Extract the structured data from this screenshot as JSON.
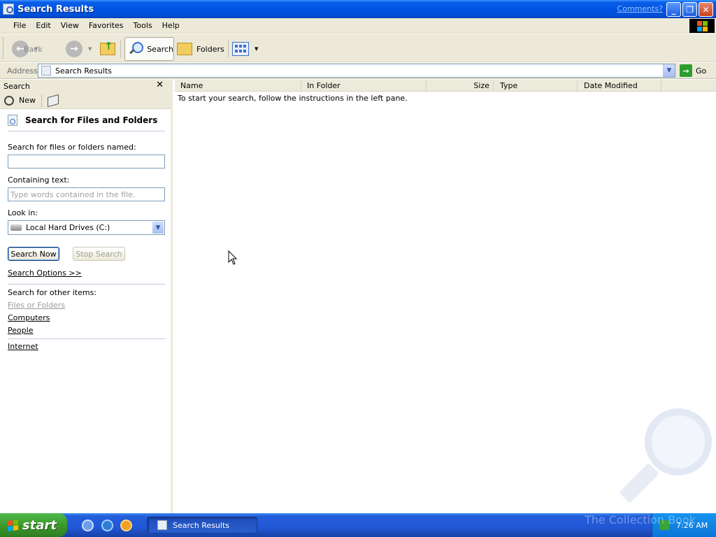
{
  "window": {
    "title": "Search Results",
    "comments_link": "Comments?",
    "controls": {
      "minimize": "_",
      "maximize": "❐",
      "close": "✕"
    }
  },
  "menu": [
    "File",
    "Edit",
    "View",
    "Favorites",
    "Tools",
    "Help"
  ],
  "toolbar": {
    "back": "Back",
    "search": "Search",
    "folders": "Folders"
  },
  "address": {
    "label": "Address",
    "value": "Search Results",
    "go": "Go"
  },
  "search_pane": {
    "header": "Search",
    "close": "✕",
    "new_label": "New",
    "title": "Search for Files and Folders",
    "named_label": "Search for files or folders named:",
    "named_value": "",
    "containing_label": "Containing text:",
    "containing_placeholder": "Type words contained in the file.",
    "look_in_label": "Look in:",
    "look_in_value": "Local Hard Drives (C:)",
    "search_now": "Search Now",
    "stop_search": "Stop Search",
    "search_options": "Search Options >>",
    "other_items_label": "Search for other items:",
    "other_items": [
      "Files or Folders",
      "Computers",
      "People"
    ],
    "internet": "Internet"
  },
  "results": {
    "columns": [
      "Name",
      "In Folder",
      "Size",
      "Type",
      "Date Modified"
    ],
    "message": "To start your search, follow the instructions in the left pane."
  },
  "taskbar": {
    "start": "start",
    "task": "Search Results",
    "clock": "7:26 AM"
  },
  "watermark_text": "The Collection Book",
  "colors": {
    "titlebar": "#0054e3",
    "taskbar": "#245edb",
    "start_button": "#3c9a2b",
    "chrome": "#ece9d8"
  }
}
